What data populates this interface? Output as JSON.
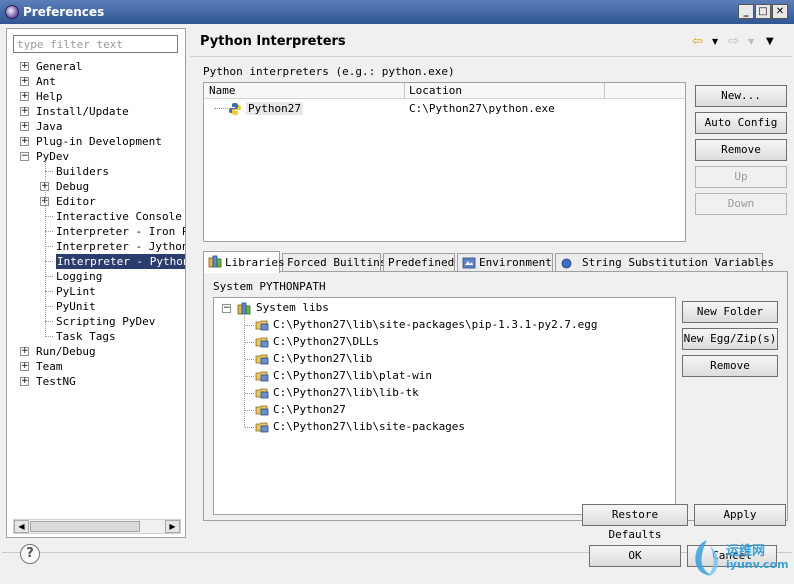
{
  "window": {
    "title": "Preferences"
  },
  "filter": {
    "placeholder": "type filter text"
  },
  "tree": [
    {
      "label": "General",
      "expander": "+"
    },
    {
      "label": "Ant",
      "expander": "+"
    },
    {
      "label": "Help",
      "expander": "+"
    },
    {
      "label": "Install/Update",
      "expander": "+"
    },
    {
      "label": "Java",
      "expander": "+"
    },
    {
      "label": "Plug-in Development",
      "expander": "+"
    },
    {
      "label": "PyDev",
      "expander": "−"
    },
    {
      "label": "Builders",
      "expander": ""
    },
    {
      "label": "Debug",
      "expander": "+"
    },
    {
      "label": "Editor",
      "expander": "+"
    },
    {
      "label": "Interactive Console",
      "expander": ""
    },
    {
      "label": "Interpreter - Iron Py",
      "expander": ""
    },
    {
      "label": "Interpreter - Jython",
      "expander": ""
    },
    {
      "label": "Interpreter - Python",
      "expander": "",
      "selected": true
    },
    {
      "label": "Logging",
      "expander": ""
    },
    {
      "label": "PyLint",
      "expander": ""
    },
    {
      "label": "PyUnit",
      "expander": ""
    },
    {
      "label": "Scripting PyDev",
      "expander": ""
    },
    {
      "label": "Task Tags",
      "expander": ""
    },
    {
      "label": "Run/Debug",
      "expander": "+"
    },
    {
      "label": "Team",
      "expander": "+"
    },
    {
      "label": "TestNG",
      "expander": "+"
    }
  ],
  "page": {
    "title": "Python Interpreters",
    "interpreters_label": "Python interpreters (e.g.: python.exe)"
  },
  "interpreter_table": {
    "columns": [
      "Name",
      "Location"
    ],
    "rows": [
      {
        "name": "Python27",
        "location": "C:\\Python27\\python.exe"
      }
    ]
  },
  "interpreter_buttons": {
    "new": "New...",
    "auto_config": "Auto Config",
    "remove": "Remove",
    "up": "Up",
    "down": "Down"
  },
  "tabs": [
    "Libraries",
    "Forced Builtins",
    "Predefined",
    "Environment",
    "String Substitution Variables"
  ],
  "libraries": {
    "label": "System PYTHONPATH",
    "root": "System libs",
    "paths": [
      "C:\\Python27\\lib\\site-packages\\pip-1.3.1-py2.7.egg",
      "C:\\Python27\\DLLs",
      "C:\\Python27\\lib",
      "C:\\Python27\\lib\\plat-win",
      "C:\\Python27\\lib\\lib-tk",
      "C:\\Python27",
      "C:\\Python27\\lib\\site-packages"
    ]
  },
  "library_buttons": {
    "new_folder": "New Folder",
    "new_egg_zip": "New Egg/Zip(s)",
    "remove": "Remove"
  },
  "footer": {
    "restore_defaults": "Restore Defaults",
    "apply": "Apply",
    "ok": "OK",
    "cancel": "Cancel",
    "help": "?"
  },
  "watermark": {
    "line1": "运维网",
    "line2": "iyunv.com"
  },
  "colors": {
    "selection": "#2b3c6e",
    "titlebar": "#2f5693",
    "watermark": "#3aa0d8"
  }
}
